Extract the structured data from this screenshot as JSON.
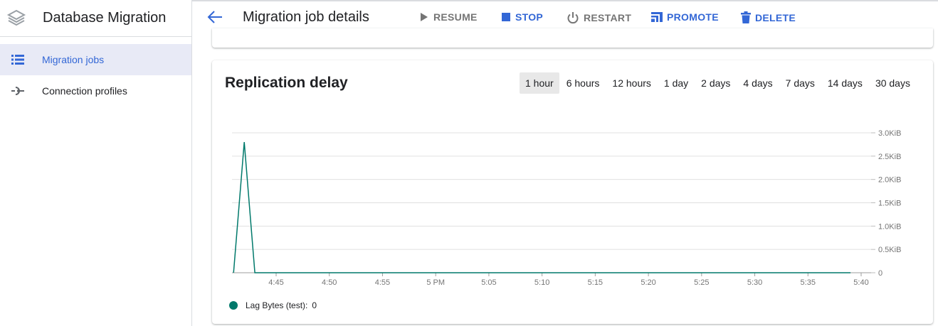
{
  "app": {
    "title": "Database Migration",
    "logo_icon": "database-migration-logo-icon"
  },
  "sidebar": {
    "items": [
      {
        "label": "Migration jobs",
        "icon": "list-icon",
        "active": true
      },
      {
        "label": "Connection profiles",
        "icon": "connection-icon",
        "active": false
      }
    ]
  },
  "toolbar": {
    "title": "Migration job details",
    "back_icon": "arrow-back-icon",
    "actions": [
      {
        "label": "RESUME",
        "icon": "play-icon",
        "enabled": false
      },
      {
        "label": "STOP",
        "icon": "stop-icon",
        "enabled": true
      },
      {
        "label": "RESTART",
        "icon": "power-icon",
        "enabled": false
      },
      {
        "label": "PROMOTE",
        "icon": "promote-icon",
        "enabled": true
      },
      {
        "label": "DELETE",
        "icon": "trash-icon",
        "enabled": true
      }
    ]
  },
  "card": {
    "title": "Replication delay",
    "ranges": [
      "1 hour",
      "6 hours",
      "12 hours",
      "1 day",
      "2 days",
      "4 days",
      "7 days",
      "14 days",
      "30 days"
    ],
    "selected_range": "1 hour"
  },
  "colors": {
    "accent": "#3367d6",
    "series": "#00796b",
    "disabled": "#757575"
  },
  "chart_data": {
    "type": "line",
    "title": "",
    "xlabel": "",
    "ylabel": "",
    "x_ticks": [
      "4:45",
      "4:50",
      "4:55",
      "5 PM",
      "5:05",
      "5:10",
      "5:15",
      "5:20",
      "5:25",
      "5:30",
      "5:35",
      "5:40"
    ],
    "y_ticks": [
      "0",
      "0.5KiB",
      "1.0KiB",
      "1.5KiB",
      "2.0KiB",
      "2.5KiB",
      "3.0KiB"
    ],
    "ylim_kib": [
      0,
      3.0
    ],
    "grid": true,
    "y_axis_position": "right",
    "series": [
      {
        "name": "Lag Bytes (test)",
        "current_value": "0",
        "points": [
          {
            "x": "4:41",
            "y_kib": 0
          },
          {
            "x": "4:42",
            "y_kib": 2.8
          },
          {
            "x": "4:43",
            "y_kib": 0
          },
          {
            "x": "5:39",
            "y_kib": 0
          }
        ]
      }
    ]
  }
}
